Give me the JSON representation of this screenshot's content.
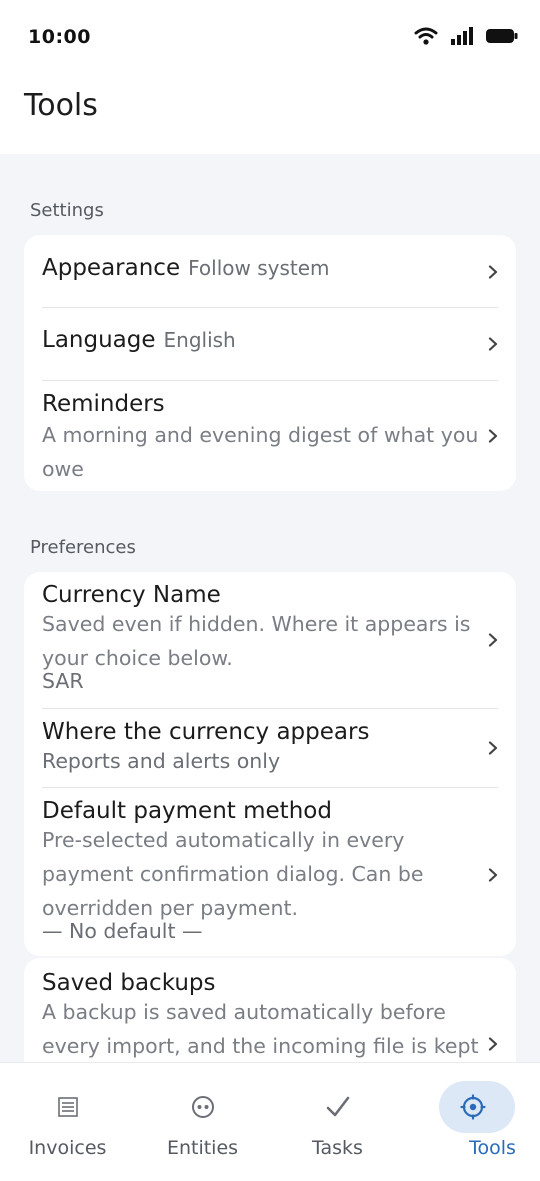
{
  "status_bar": {
    "time": "10:00"
  },
  "header": {
    "title": "Tools"
  },
  "settings": {
    "label": "Settings",
    "items": [
      {
        "title": "Appearance",
        "value": "Follow system"
      },
      {
        "title": "Language",
        "value": "English"
      },
      {
        "title": "Reminders",
        "subtitle": "A morning and evening digest of what you owe"
      }
    ]
  },
  "preferences": {
    "label": "Preferences",
    "items": [
      {
        "title": "Currency Name",
        "subtitle": "Saved even if hidden. Where it appears is your choice below.",
        "value": "SAR"
      },
      {
        "title": "Where the currency appears",
        "value": "Reports and alerts only"
      },
      {
        "title": "Default payment method",
        "subtitle": "Pre-selected automatically in every payment confirmation dialog. Can be overridden per payment.",
        "value": "— No default —"
      }
    ]
  },
  "backups": {
    "title": "Saved backups",
    "subtitle": "A backup is saved automatically before every import, and the incoming file is kept as"
  },
  "nav": {
    "items": [
      {
        "label": "Invoices",
        "icon": "list-icon",
        "active": false
      },
      {
        "label": "Entities",
        "icon": "entity-icon",
        "active": false
      },
      {
        "label": "Tasks",
        "icon": "check-icon",
        "active": false
      },
      {
        "label": "Tools",
        "icon": "gear-icon",
        "active": true
      }
    ],
    "active_color": "#2a6bb8",
    "active_pill_color": "#dde8f6"
  }
}
